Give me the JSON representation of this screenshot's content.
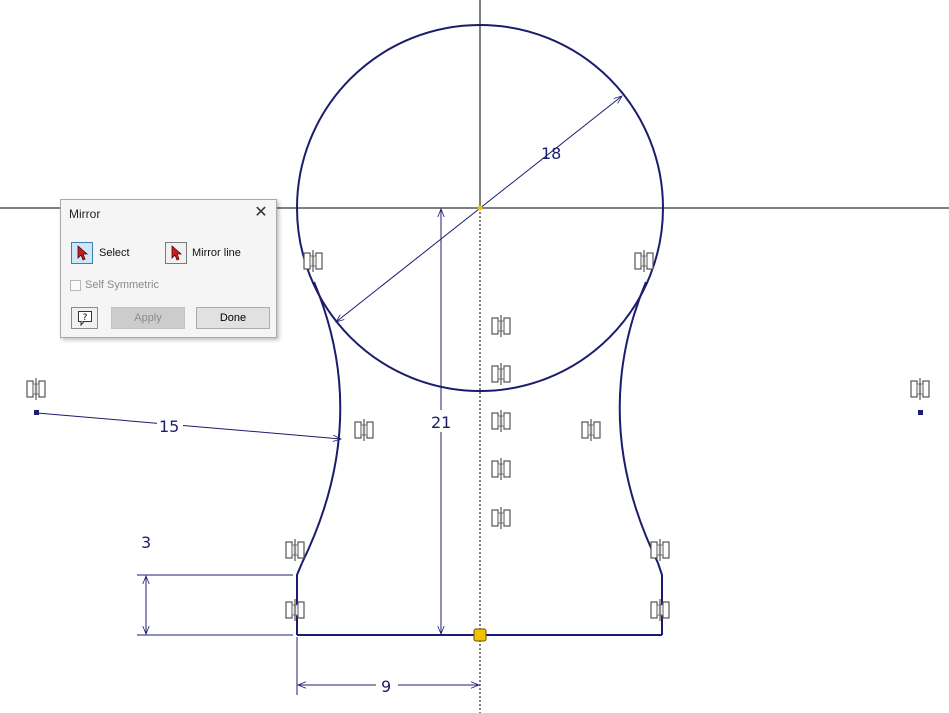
{
  "dialog": {
    "title": "Mirror",
    "select_label": "Select",
    "mirror_line_label": "Mirror line",
    "self_symmetric_label": "Self Symmetric",
    "apply_label": "Apply",
    "done_label": "Done",
    "help_icon": "help-icon",
    "close_icon": "close-icon"
  },
  "sketch": {
    "dimensions": {
      "diameter": "18",
      "height": "21",
      "radius": "15",
      "step": "3",
      "half_width": "9"
    },
    "colors": {
      "geometry": "#1c1c6e",
      "axis": "#000000",
      "anchor": "#f2c200"
    },
    "constraint_icon": "symmetric-constraint-icon"
  }
}
